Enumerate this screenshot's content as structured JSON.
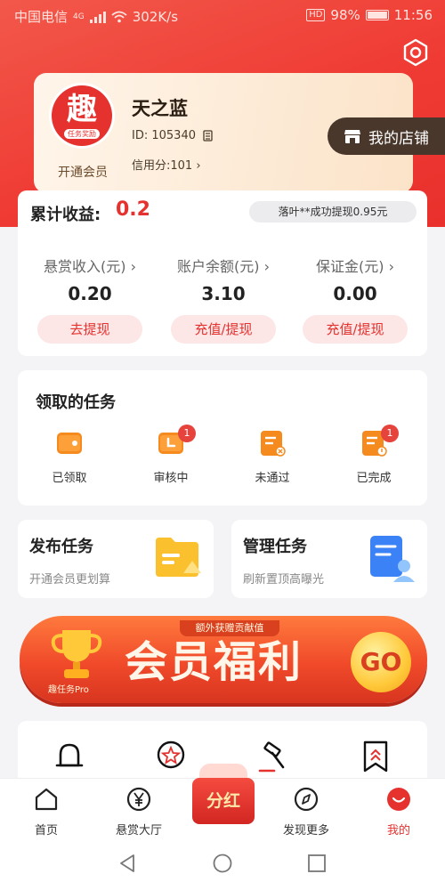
{
  "status_bar": {
    "carrier": "中国电信",
    "network": "4G",
    "speed": "302K/s",
    "hd": "HD",
    "battery": "98%",
    "time": "11:56"
  },
  "profile": {
    "avatar_char": "趣",
    "avatar_sub": "任务奖励",
    "open_member": "开通会员",
    "name": "天之蓝",
    "id_text": "ID: 105340",
    "credit_text": "信用分:101",
    "shop_label": "我的店铺"
  },
  "earnings": {
    "label": "累计收益:",
    "value": "0.2",
    "notice": "落叶**成功提现0.95元",
    "columns": [
      {
        "title": "悬赏收入(元)",
        "value": "0.20",
        "button": "去提现"
      },
      {
        "title": "账户余额(元)",
        "value": "3.10",
        "button": "充值/提现"
      },
      {
        "title": "保证金(元)",
        "value": "0.00",
        "button": "充值/提现"
      }
    ]
  },
  "tasks": {
    "title": "领取的任务",
    "items": [
      {
        "label": "已领取",
        "badge": ""
      },
      {
        "label": "审核中",
        "badge": "1"
      },
      {
        "label": "未通过",
        "badge": ""
      },
      {
        "label": "已完成",
        "badge": "1"
      }
    ]
  },
  "publish": {
    "title": "发布任务",
    "subtitle": "开通会员更划算"
  },
  "manage": {
    "title": "管理任务",
    "subtitle": "刷新置顶高曝光"
  },
  "banner": {
    "tag": "额外获赠贡献值",
    "text": "会员福利",
    "go": "GO",
    "pro": "趣任务Pro"
  },
  "tabbar": {
    "items": [
      {
        "label": "首页"
      },
      {
        "label": "悬赏大厅"
      },
      {
        "label": "分红"
      },
      {
        "label": "发现更多"
      },
      {
        "label": "我的"
      }
    ]
  },
  "colors": {
    "primary": "#e5322f",
    "shop_bg": "#4a372c",
    "card_gold": "#fbe3c8"
  }
}
